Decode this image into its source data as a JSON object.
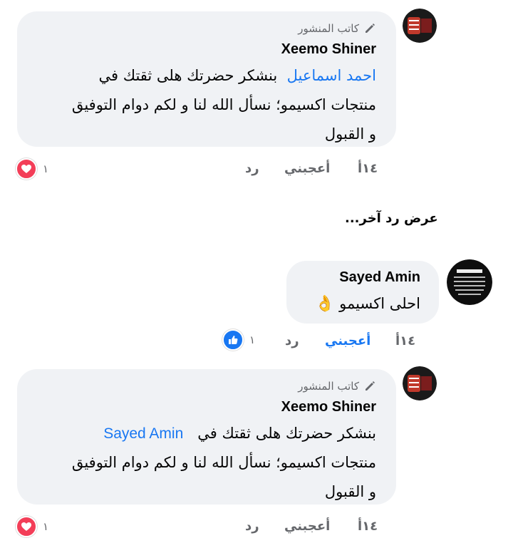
{
  "comments": [
    {
      "author_badge": "كاتب المنشور",
      "author": "Xeemo Shiner",
      "mention": "احمد اسماعيل",
      "text_line1": "بنشكر حضرتك هلى ثقتك في",
      "text_line2": "منتجات اكسيمو؛ نسأل الله لنا و لكم دوام التوفيق",
      "text_line3": "و القبول",
      "time": "١٤أ",
      "like_label": "أعجبني",
      "reply_label": "رد",
      "reaction": "heart",
      "reaction_count": "١"
    },
    {
      "author": "Sayed Amin",
      "text": "احلى اكسيمو",
      "emoji": "👌",
      "time": "١٤أ",
      "like_label": "أعجبني",
      "reply_label": "رد",
      "reaction": "like",
      "reaction_count": "١"
    },
    {
      "author_badge": "كاتب المنشور",
      "author": "Xeemo Shiner",
      "mention": "Sayed Amin",
      "text_line1": "بنشكر حضرتك هلى ثقتك في",
      "text_line2": "منتجات اكسيمو؛ نسأل الله لنا و لكم دوام التوفيق",
      "text_line3": "و القبول",
      "time": "١٤أ",
      "like_label": "أعجبني",
      "reply_label": "رد",
      "reaction": "heart",
      "reaction_count": "١"
    }
  ],
  "more_replies": "عرض رد آخر...",
  "colors": {
    "bubble": "#f0f2f5",
    "mention": "#1877f2",
    "liked": "#1877f2",
    "heart": "#f33e58",
    "meta": "#65676b"
  }
}
